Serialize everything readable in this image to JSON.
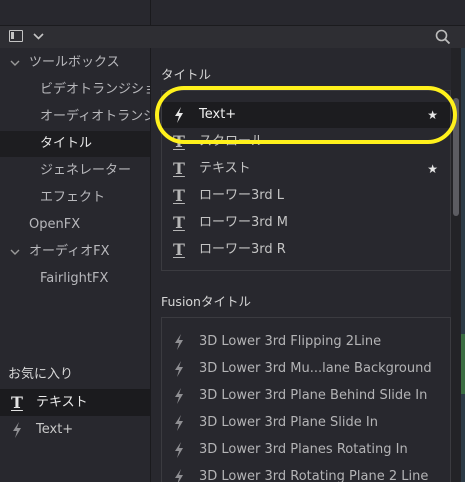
{
  "sidebar": {
    "items": [
      {
        "label": "ツールボックス",
        "expanded": true
      },
      {
        "label": "ビデオトランジション"
      },
      {
        "label": "オーディオトランジ..."
      },
      {
        "label": "タイトル",
        "selected": true
      },
      {
        "label": "ジェネレーター"
      },
      {
        "label": "エフェクト"
      },
      {
        "label": "OpenFX"
      },
      {
        "label": "オーディオFX",
        "expanded": true
      },
      {
        "label": "FairlightFX"
      }
    ],
    "favorites": {
      "header": "お気に入り",
      "items": [
        {
          "label": "テキスト",
          "icon": "text-t-icon",
          "selected": true
        },
        {
          "label": "Text+",
          "icon": "lightning-icon"
        }
      ]
    }
  },
  "titles": {
    "header": "タイトル",
    "items": [
      {
        "label": "Text+",
        "icon": "lightning-icon",
        "favorite": true,
        "selected": true
      },
      {
        "label": "スクロール",
        "icon": "text-t-icon",
        "favorite": false
      },
      {
        "label": "テキスト",
        "icon": "text-t-icon",
        "favorite": true
      },
      {
        "label": "ローワー3rd L",
        "icon": "text-t-icon",
        "favorite": false
      },
      {
        "label": "ローワー3rd M",
        "icon": "text-t-icon",
        "favorite": false
      },
      {
        "label": "ローワー3rd R",
        "icon": "text-t-icon",
        "favorite": false
      }
    ]
  },
  "fusion": {
    "header": "Fusionタイトル",
    "items": [
      {
        "label": "3D Lower 3rd Flipping 2Line"
      },
      {
        "label": "3D Lower 3rd Mu...lane Background"
      },
      {
        "label": "3D Lower 3rd Plane Behind Slide In"
      },
      {
        "label": "3D Lower 3rd Plane Slide In"
      },
      {
        "label": "3D Lower 3rd Planes Rotating In"
      },
      {
        "label": "3D Lower 3rd Rotating Plane 2 Line"
      }
    ]
  },
  "icons": {
    "star": "★",
    "text_t": "T",
    "chevron": "⌄",
    "caret_down": "⌄"
  },
  "colors": {
    "highlight": "#fff11c",
    "background": "#28282e",
    "selected_row": "#1c1c1f"
  }
}
